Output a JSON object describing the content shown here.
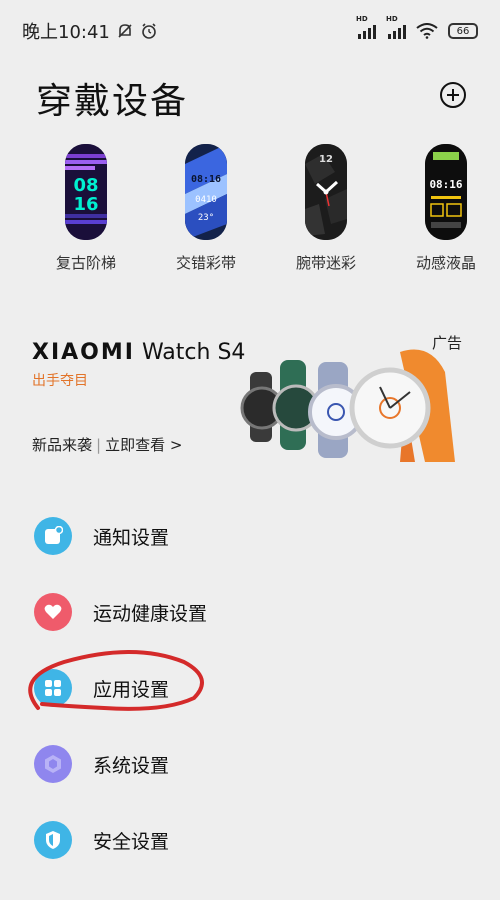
{
  "status_bar": {
    "time": "晚上10:41",
    "hd1": "HD",
    "hd2": "HD",
    "battery": "66"
  },
  "header": {
    "title": "穿戴设备"
  },
  "watch_faces": [
    {
      "label": "复古阶梯",
      "face_text": [
        "08",
        "16"
      ]
    },
    {
      "label": "交错彩带",
      "face_text": [
        "08:16",
        "0410",
        "23°"
      ]
    },
    {
      "label": "腕带迷彩",
      "face_text": [
        "12"
      ]
    },
    {
      "label": "动感液晶",
      "face_text": [
        "08:16"
      ]
    }
  ],
  "ad": {
    "brand_bold": "XIAOMI",
    "brand_rest": " Watch S4",
    "subtitle": "出手夺目",
    "tag": "广告",
    "link_left": "新品来袭",
    "link_right": "立即查看 >"
  },
  "menu": [
    {
      "label": "通知设置",
      "icon": "notification-icon",
      "color": "#3fb5e6"
    },
    {
      "label": "运动健康设置",
      "icon": "heart-icon",
      "color": "#ef5b6b"
    },
    {
      "label": "应用设置",
      "icon": "apps-grid-icon",
      "color": "#3fb5e6"
    },
    {
      "label": "系统设置",
      "icon": "system-hexagon-icon",
      "color": "#8f86ee"
    },
    {
      "label": "安全设置",
      "icon": "shield-icon",
      "color": "#3fb5e6"
    }
  ]
}
